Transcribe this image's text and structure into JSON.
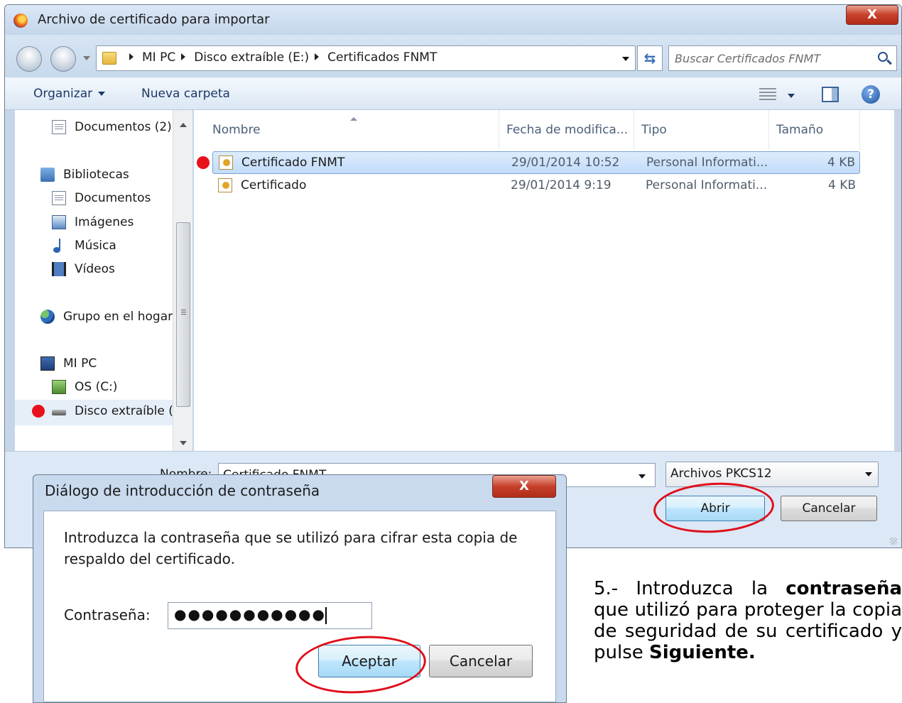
{
  "file_dialog": {
    "title": "Archivo de certificado para importar",
    "close_label": "X",
    "breadcrumb": [
      "MI PC",
      "Disco extraíble (E:)",
      "Certificados FNMT"
    ],
    "search_placeholder": "Buscar Certificados FNMT",
    "toolbar": {
      "organize_label": "Organizar",
      "new_folder_label": "Nueva carpeta"
    },
    "nav": {
      "items": [
        {
          "label": "Documentos (2)",
          "icon": "document-icon"
        },
        {
          "label": "Bibliotecas",
          "icon": "library-icon"
        },
        {
          "label": "Documentos",
          "icon": "document-icon"
        },
        {
          "label": "Imágenes",
          "icon": "pictures-icon"
        },
        {
          "label": "Música",
          "icon": "music-icon"
        },
        {
          "label": "Vídeos",
          "icon": "videos-icon"
        },
        {
          "label": "Grupo en el hogar",
          "icon": "homegroup-icon"
        },
        {
          "label": "MI PC",
          "icon": "computer-icon"
        },
        {
          "label": "OS (C:)",
          "icon": "drive-icon"
        },
        {
          "label": "Disco extraíble (E",
          "icon": "usb-drive-icon"
        }
      ]
    },
    "columns": {
      "name": "Nombre",
      "date": "Fecha de modifica...",
      "type": "Tipo",
      "size": "Tamaño"
    },
    "files": [
      {
        "name": "Certificado FNMT",
        "date": "29/01/2014 10:52",
        "type": "Personal Informati...",
        "size": "4 KB",
        "selected": true
      },
      {
        "name": "Certificado",
        "date": "29/01/2014 9:19",
        "type": "Personal Informati...",
        "size": "4 KB",
        "selected": false
      }
    ],
    "filename_label": "Nombre:",
    "filename_value": "Certificado FNMT",
    "filetype_value": "Archivos PKCS12",
    "open_label": "Abrir",
    "cancel_label": "Cancelar"
  },
  "password_dialog": {
    "title": "Diálogo de introducción de contraseña",
    "close_label": "X",
    "message": "Introduzca la contraseña que se utilizó para cifrar esta copia de respaldo del certificado.",
    "password_label": "Contraseña:",
    "password_mask": "●●●●●●●●●●●",
    "accept_label": "Aceptar",
    "cancel_label": "Cancelar"
  },
  "instruction": {
    "prefix": "5.- Introduzca la ",
    "bold1": "contraseña",
    "middle": " que utilizó para proteger la copia de seguridad de su certificado y pulse ",
    "bold2": "Siguiente."
  },
  "colors": {
    "highlight_red": "#e00e1a",
    "marker_red": "#e8111b",
    "selection_blue": "#c2dcfa"
  }
}
